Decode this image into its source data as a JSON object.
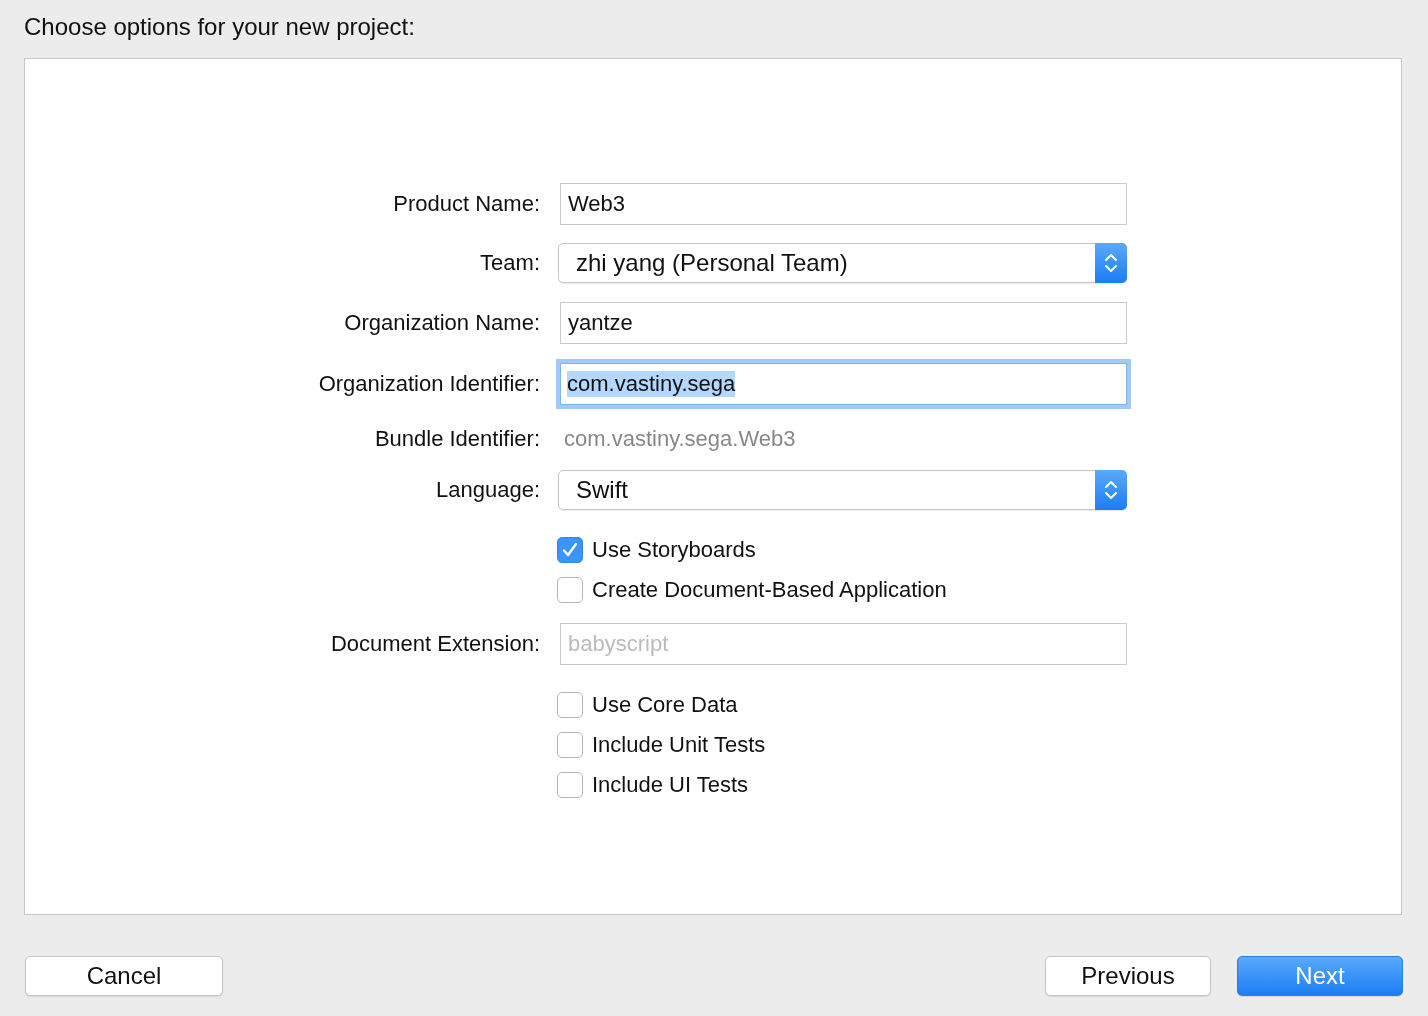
{
  "title": "Choose options for your new project:",
  "rows": [
    {
      "kind": "text",
      "label": "Product Name:",
      "value": "Web3",
      "focused": false
    },
    {
      "kind": "popup",
      "label": "Team:",
      "value": "zhi yang (Personal Team)"
    },
    {
      "kind": "text",
      "label": "Organization Name:",
      "value": "yantze",
      "focused": false
    },
    {
      "kind": "text",
      "label": "Organization Identifier:",
      "value": "com.vastiny.sega",
      "focused": true
    },
    {
      "kind": "static",
      "label": "Bundle Identifier:",
      "value": "com.vastiny.sega.Web3"
    },
    {
      "kind": "popup",
      "label": "Language:",
      "value": "Swift"
    },
    {
      "kind": "checkbox",
      "label": "Use Storyboards",
      "checked": true
    },
    {
      "kind": "checkbox",
      "label": "Create Document-Based Application",
      "checked": false
    },
    {
      "kind": "text",
      "label": "Document Extension:",
      "placeholder": "babyscript",
      "focused": false
    },
    {
      "kind": "checkbox",
      "label": "Use Core Data",
      "checked": false
    },
    {
      "kind": "checkbox",
      "label": "Include Unit Tests",
      "checked": false
    },
    {
      "kind": "checkbox",
      "label": "Include UI Tests",
      "checked": false
    }
  ],
  "buttons": [
    {
      "label": "Cancel",
      "primary": false
    },
    {
      "label": "Previous",
      "primary": false
    },
    {
      "label": "Next",
      "primary": true
    }
  ]
}
